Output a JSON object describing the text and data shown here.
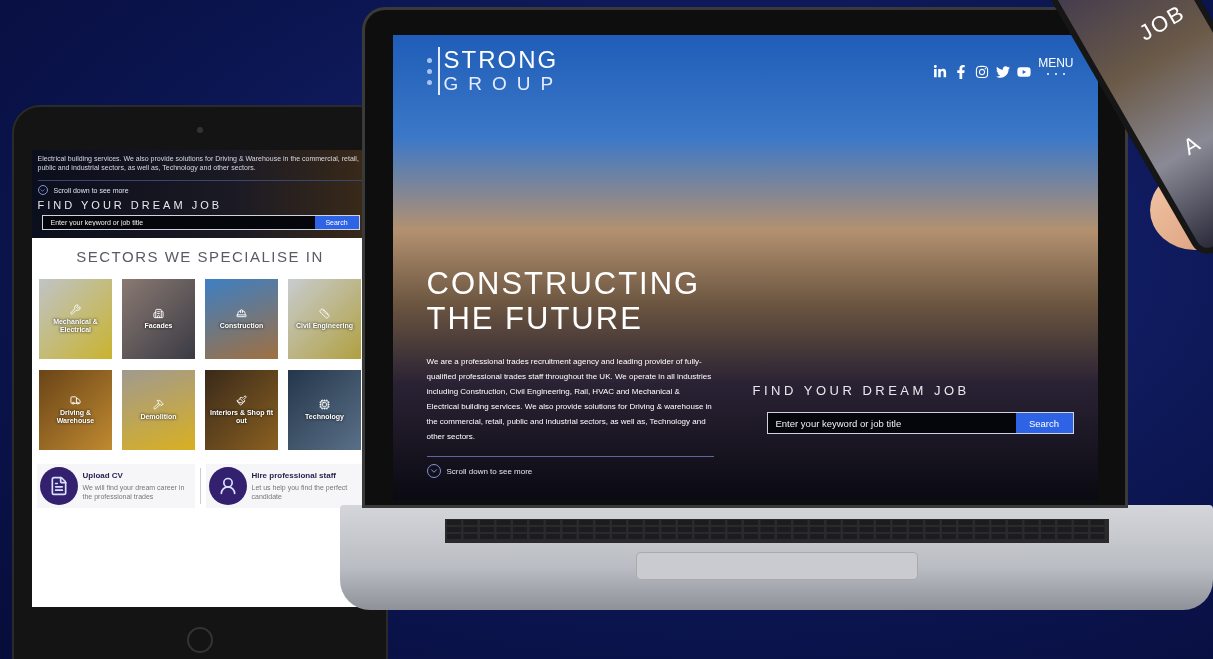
{
  "tablet": {
    "intro": "Electrical building services. We also provide solutions for Driving & Warehouse in the commercial, retail, public and industrial sectors, as well as, Technology and other sectors.",
    "scroll_hint": "Scroll down to see more",
    "search_title": "FIND YOUR DREAM JOB",
    "search": {
      "placeholder": "Enter your keyword or job title",
      "button": "Search"
    },
    "sectors_title": "SECTORS WE SPECIALISE IN",
    "sectors": [
      {
        "label": "Mechanical & Electrical"
      },
      {
        "label": "Facades"
      },
      {
        "label": "Construction"
      },
      {
        "label": "Civil Engineering"
      },
      {
        "label": "Driving & Warehouse"
      },
      {
        "label": "Demolition"
      },
      {
        "label": "Interiors & Shop fit out"
      },
      {
        "label": "Technology"
      }
    ],
    "cards": [
      {
        "title": "Upload CV",
        "text": "We will find your dream career in the professional trades"
      },
      {
        "title": "Hire professional staff",
        "text": "Let us help you find the perfect candidate"
      }
    ]
  },
  "laptop": {
    "logo": {
      "name": "STRONG",
      "sub": "GROUP"
    },
    "menu": "MENU",
    "hero_title": [
      "CONSTRUCTING",
      "THE FUTURE"
    ],
    "intro": "We are a professional trades recruitment agency and leading provider of fully-qualified professional trades staff throughout the UK. We operate in all industries including Construction, Civil Engineering, Rail, HVAC and Mechanical & Electrical building services. We also provide solutions for Driving & warehouse in the commercial, retail, public and industrial sectors, as well as, Technology and other sectors.",
    "scroll_hint": "Scroll down to see more",
    "search_title": "FIND YOUR DREAM JOB",
    "search": {
      "placeholder": "Enter your keyword or job title",
      "button": "Search"
    }
  },
  "phone": {
    "texts": [
      "JOB",
      "A"
    ]
  }
}
